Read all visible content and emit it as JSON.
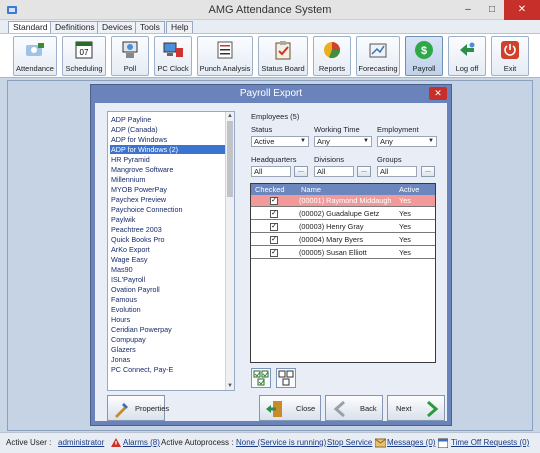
{
  "window": {
    "title": "AMG Attendance System",
    "minimize": "–",
    "maximize": "□",
    "close": "✕"
  },
  "menu": {
    "tabs": [
      "Standard",
      "Definitions",
      "Devices",
      "Tools",
      "Help"
    ]
  },
  "toolbar": {
    "buttons": [
      {
        "label": "Attendance",
        "icon": "attendance-icon"
      },
      {
        "label": "Scheduling",
        "icon": "calendar-icon"
      },
      {
        "label": "Poll",
        "icon": "poll-icon"
      },
      {
        "label": "PC Clock",
        "icon": "pc-clock-icon"
      },
      {
        "label": "Punch Analysis",
        "icon": "list-icon"
      },
      {
        "label": "Status Board",
        "icon": "clipboard-icon"
      },
      {
        "label": "Reports",
        "icon": "pie-chart-icon"
      },
      {
        "label": "Forecasting",
        "icon": "forecast-icon"
      },
      {
        "label": "Payroll",
        "icon": "dollar-icon"
      },
      {
        "label": "Log off",
        "icon": "logoff-icon"
      },
      {
        "label": "Exit",
        "icon": "power-icon"
      }
    ]
  },
  "dialog": {
    "title": "Payroll Export",
    "close": "✕",
    "providers": [
      "ADP Payline",
      "ADP (Canada)",
      "ADP for Windows",
      "ADP for Windows (2)",
      "HR Pyramid",
      "Mangrove Software",
      "Millennium",
      "MYOB PowerPay",
      "Paychex Preview",
      "Paychoice Connection",
      "Paylwik",
      "Peachtree 2003",
      "Quick Books Pro",
      "ArKo Export",
      "Wage Easy",
      "Mas90",
      "ISL'Payroll",
      "Ovation Payroll",
      "Famous",
      "Evolution",
      "Hours",
      "Ceridian Powerpay",
      "Compupay",
      "Glazers",
      "Jonas",
      "PC Connect, Pay-E"
    ],
    "selected_provider": "ADP for Windows (2)",
    "employees_label": "Employees (5)",
    "status": {
      "label": "Status",
      "value": "Active"
    },
    "working_time": {
      "label": "Working Time",
      "value": "Any"
    },
    "employment": {
      "label": "Employment",
      "value": "Any"
    },
    "headquarters": {
      "label": "Headquarters",
      "value": "All"
    },
    "divisions": {
      "label": "Divisions",
      "value": "All"
    },
    "groups": {
      "label": "Groups",
      "value": "All"
    },
    "dots": "...",
    "grid": {
      "headers": {
        "checked": "Checked",
        "name": "Name",
        "active": "Active"
      },
      "rows": [
        {
          "name": "(00001) Raymond Middaugh",
          "active": "Yes",
          "checked": "✓"
        },
        {
          "name": "(00002) Guadalupe Getz",
          "active": "Yes",
          "checked": "✓"
        },
        {
          "name": "(00003) Henry Gray",
          "active": "Yes",
          "checked": "✓"
        },
        {
          "name": "(00004) Mary Byers",
          "active": "Yes",
          "checked": "✓"
        },
        {
          "name": "(00005) Susan Elliott",
          "active": "Yes",
          "checked": "✓"
        }
      ]
    },
    "buttons": {
      "properties": "Properties",
      "close": "Close",
      "back": "Back",
      "next": "Next"
    }
  },
  "status_bar": {
    "active_user_label": "Active User :",
    "active_user": "administrator",
    "alarms": "Alarms (8)",
    "autoprocess_label": "Active Autoprocess :",
    "autoprocess": "None (Service is running)",
    "stop_service": "Stop Service",
    "messages": "Messages (0)",
    "time_off": "Time Off Requests (0)"
  },
  "colors": {
    "dialog_frame": "#6a84bb",
    "grid_header": "#6c86be",
    "highlight_row": "#f29a9a",
    "selection": "#3b73d0"
  }
}
